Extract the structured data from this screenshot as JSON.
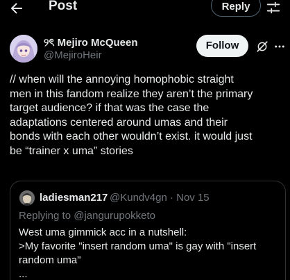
{
  "header": {
    "title": "Post",
    "reply_label": "Reply",
    "back_icon": "arrow-left-icon",
    "adjust_icon": "sliders-icon"
  },
  "post": {
    "author_name": "୨ৎ Mejiro McQueen",
    "author_handle": "@MejiroHeir",
    "follow_label": "Follow",
    "text_lines": [
      "// when will the annoying homophobic straight",
      "men in this fandom realize they aren’t the primary",
      "target audience? if that was the case the",
      "adaptations centered around umas and their",
      "bonds with each other wouldn’t exist. it would just",
      "be “trainer x uma” stories"
    ]
  },
  "quote": {
    "author_name": "ladiesman217",
    "author_handle": "@Kundv4gn · Nov 15",
    "replying_prefix": "Replying to ",
    "replying_to": "@jangurupokketo",
    "text_lines": [
      "West uma gimmick acc in a nutshell:",
      ">My favorite \"insert random uma\" is gay with \"insert",
      "random uma\"",
      "..."
    ]
  },
  "colors": {
    "background": "#000000",
    "text": "#e7e9ea",
    "muted": "#71767b",
    "border": "#2f3336",
    "follow_bg": "#eff3f4"
  }
}
